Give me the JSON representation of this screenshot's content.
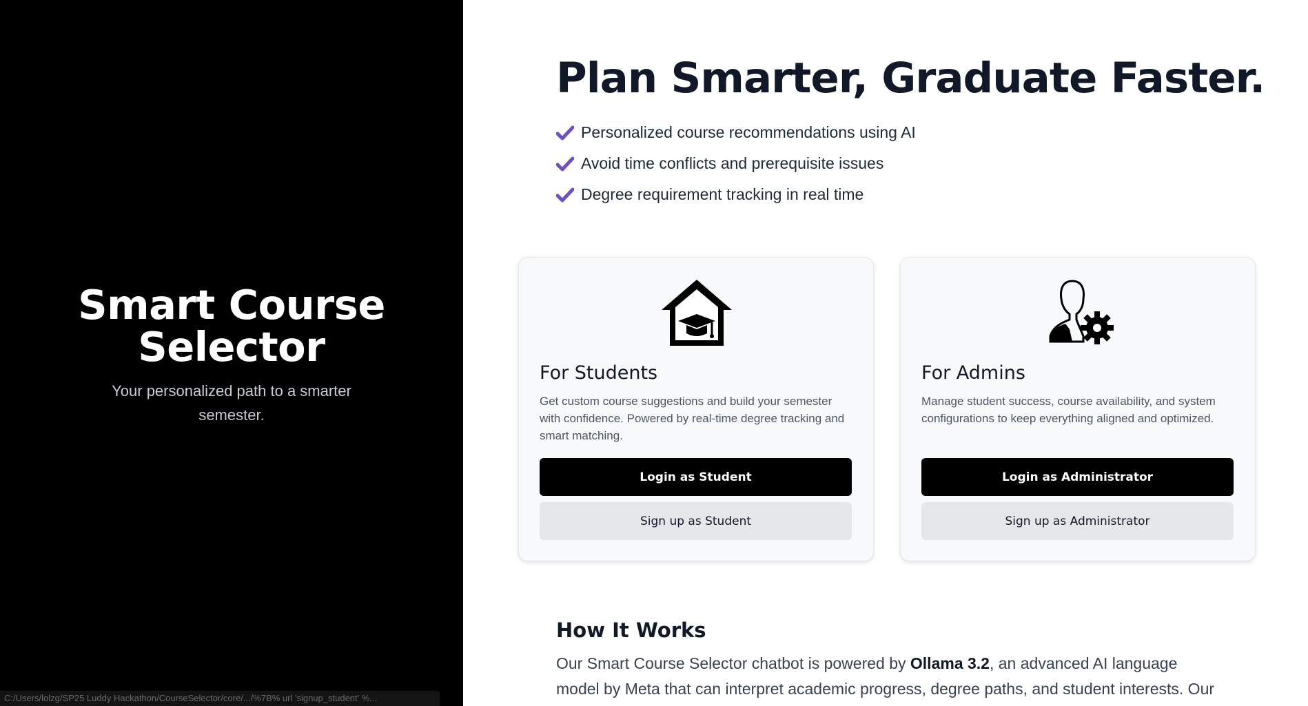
{
  "brand": {
    "title_line1": "Smart Course",
    "title_line2": "Selector",
    "subtitle": "Your personalized path to a smarter semester."
  },
  "status_bar": {
    "url": "C:/Users/lolzg/SP25 Luddy Hackathon/CourseSelector/core/.../%7B% url 'signup_student' %..."
  },
  "hero": {
    "headline": "Plan Smarter, Graduate Faster.",
    "features": [
      "Personalized course recommendations using AI",
      "Avoid time conflicts and prerequisite issues",
      "Degree requirement tracking in real time"
    ],
    "check_icon": "checkmark-icon",
    "accent_color": "#6d4fc2"
  },
  "students_card": {
    "icon": "graduation-house-icon",
    "title": "For Students",
    "description": "Get custom course suggestions and build your semester with confidence. Powered by real-time degree tracking and smart matching.",
    "login_label": "Login as Student",
    "signup_label": "Sign up as Student"
  },
  "admins_card": {
    "icon": "admin-gear-icon",
    "title": "For Admins",
    "description": "Manage student success, course availability, and system configurations to keep everything aligned and optimized.",
    "login_label": "Login as Administrator",
    "signup_label": "Sign up as Administrator"
  },
  "how_it_works": {
    "title": "How It Works",
    "text_before": "Our Smart Course Selector chatbot is powered by ",
    "model_name": "Ollama 3.2",
    "text_after": ", an advanced AI language model by Meta that can interpret academic progress, degree paths, and student interests. Our"
  }
}
